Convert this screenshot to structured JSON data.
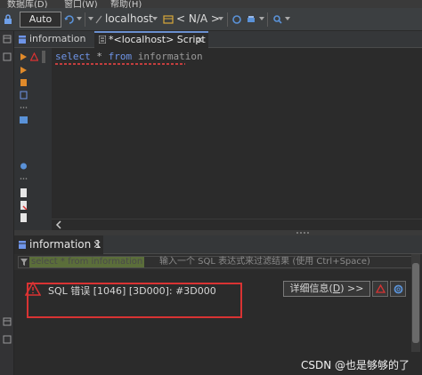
{
  "menubar": {
    "items": [
      "数据库(D)",
      "窗口(W)",
      "帮助(H)"
    ]
  },
  "toolbar": {
    "transaction_mode": "Auto",
    "datasource": "localhost",
    "schema": "< N/A >",
    "icons": [
      "lock-icon",
      "commit-mode-icon",
      "transaction-icon",
      "datasource-icon",
      "schema-icon",
      "refresh-icon",
      "print-icon",
      "search-icon"
    ]
  },
  "editor_tabs": [
    {
      "label": "information",
      "active": false,
      "icon": "table-icon"
    },
    {
      "label": "*<localhost> Script",
      "active": true,
      "icon": "sql-script-icon",
      "close": "×"
    }
  ],
  "editor": {
    "tokens": {
      "select": "select",
      "star": "*",
      "from": "from",
      "table": "information"
    },
    "caret_gutter_marks": [
      "run-arrow-icon",
      "warning-icon"
    ]
  },
  "results": {
    "tab_label": "information 1",
    "tab_close": "×",
    "filter_chip": "select * from information",
    "filter_placeholder": "输入一个 SQL 表达式来过滤结果 (使用 Ctrl+Space)",
    "error_message": "SQL 错误 [1046] [3D000]: #3D000",
    "details_button_prefix": "详细信息(",
    "details_button_key": "D",
    "details_button_suffix": ") >>"
  },
  "colors": {
    "keyword": "#6f95e8",
    "error": "#d93333",
    "accent": "#6a8fd0",
    "background": "#2b2b2b"
  },
  "watermark": "CSDN @也是够够的了"
}
